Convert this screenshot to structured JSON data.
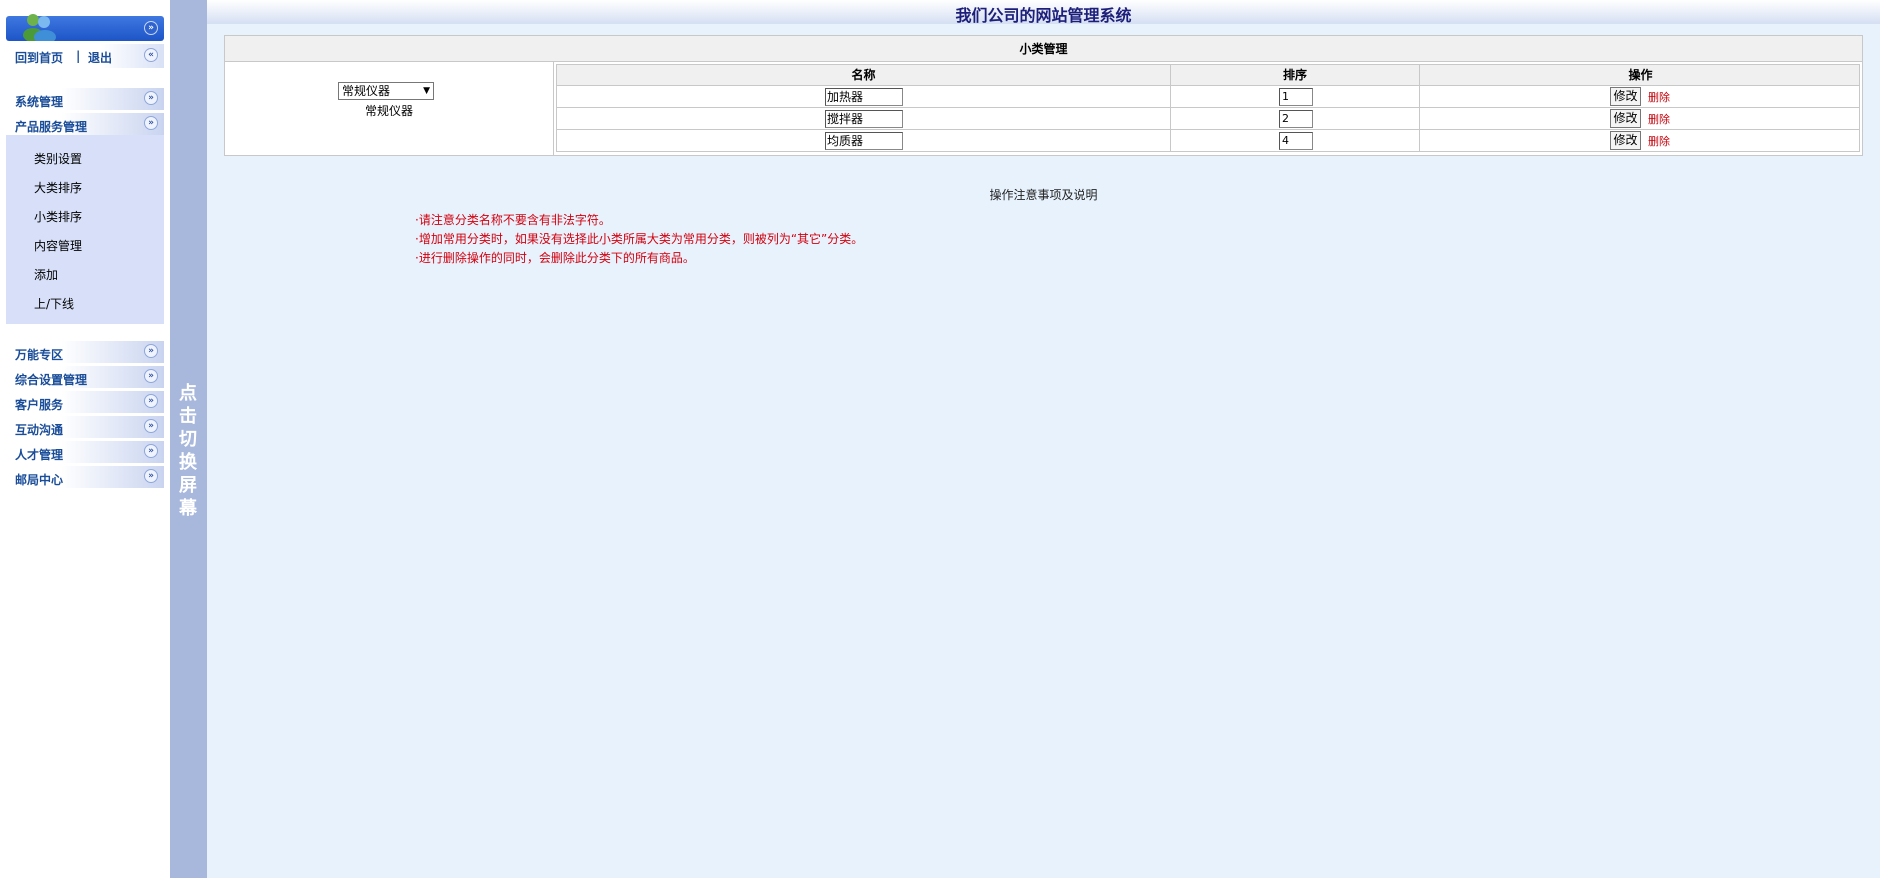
{
  "left_menu": {
    "home_link": "回到首页",
    "separator": "|",
    "logout_link": "退出",
    "sections": [
      {
        "label": "系统管理"
      },
      {
        "label": "产品服务管理"
      },
      {
        "label": "万能专区"
      },
      {
        "label": "综合设置管理"
      },
      {
        "label": "客户服务"
      },
      {
        "label": "互动沟通"
      },
      {
        "label": "人才管理"
      },
      {
        "label": "邮局中心"
      }
    ],
    "submenu": [
      "类别设置",
      "大类排序",
      "小类排序",
      "内容管理",
      "添加",
      "上/下线"
    ]
  },
  "splitter": {
    "text": "点击切换屏幕"
  },
  "header": {
    "title": "我们公司的网站管理系统"
  },
  "panel": {
    "title": "小类管理",
    "category_select": {
      "selected": "常规仪器"
    },
    "category_label": "常规仪器",
    "columns": [
      "名称",
      "排序",
      "操作"
    ],
    "rows": [
      {
        "name": "加热器",
        "order": "1",
        "edit": "修改",
        "delete": "删除"
      },
      {
        "name": "搅拌器",
        "order": "2",
        "edit": "修改",
        "delete": "删除"
      },
      {
        "name": "均质器",
        "order": "4",
        "edit": "修改",
        "delete": "删除"
      }
    ]
  },
  "notes": {
    "title": "操作注意事项及说明",
    "items": [
      "·请注意分类名称不要含有非法字符。",
      "·增加常用分类时，如果没有选择此小类所属大类为常用分类，则被列为“其它”分类。",
      "·进行删除操作的同时，会删除此分类下的所有商品。"
    ]
  },
  "colors": {
    "accent": "#1a4d99",
    "title": "#1c1e7a",
    "warning": "#d4000d",
    "splitter": "#a8b7dc",
    "background": "#e7f2fd"
  }
}
